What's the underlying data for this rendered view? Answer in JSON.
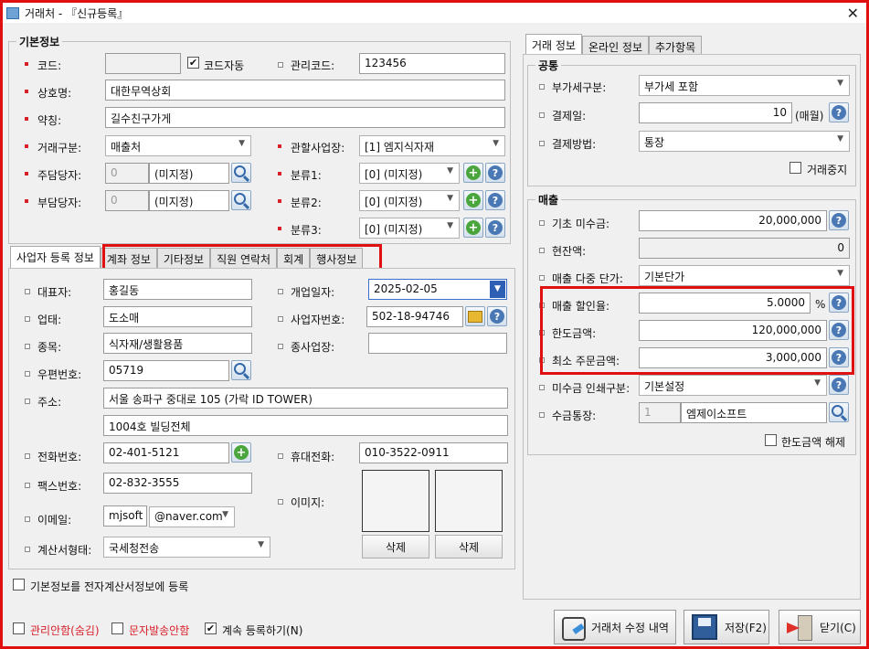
{
  "window": {
    "title": "거래처 - 『신규등록』"
  },
  "basic": {
    "group_title": "기본정보",
    "code_label": "코드:",
    "code_value": "",
    "auto_code_label": "코드자동",
    "auto_code_checked": "✔",
    "mgmt_code_label": "관리코드:",
    "mgmt_code_value": "123456",
    "name_label": "상호명:",
    "name_value": "대한무역상회",
    "short_label": "약칭:",
    "short_value": "길수친구가게",
    "type_label": "거래구분:",
    "type_value": "매출처",
    "site_label": "관할사업장:",
    "site_value": "[1] 엠지식자재",
    "main_mgr_label": "주담당자:",
    "main_mgr_code": "0",
    "main_mgr_value": "(미지정)",
    "sub_mgr_label": "부담당자:",
    "sub_mgr_code": "0",
    "sub_mgr_value": "(미지정)",
    "cat1_label": "분류1:",
    "cat1_value": "[0] (미지정)",
    "cat2_label": "분류2:",
    "cat2_value": "[0] (미지정)",
    "cat3_label": "분류3:",
    "cat3_value": "[0] (미지정)"
  },
  "left_tabs": [
    "사업자 등록 정보",
    "계좌 정보",
    "기타정보",
    "직원 연락처",
    "회계",
    "행사정보"
  ],
  "biz": {
    "ceo_label": "대표자:",
    "ceo_value": "홍길동",
    "open_label": "개업일자:",
    "open_value": "2025-02-05",
    "biztype_label": "업태:",
    "biztype_value": "도소매",
    "bizno_label": "사업자번호:",
    "bizno_value": "502-18-94746",
    "item_label": "종목:",
    "item_value": "식자재/생활용품",
    "branch_label": "종사업장:",
    "branch_value": "",
    "zip_label": "우편번호:",
    "zip_value": "05719",
    "addr_label": "주소:",
    "addr1_value": "서울 송파구 중대로 105 (가락 ID TOWER)",
    "addr2_value": "1004호 빌딩전체",
    "tel_label": "전화번호:",
    "tel_value": "02-401-5121",
    "mobile_label": "휴대전화:",
    "mobile_value": "010-3522-0911",
    "fax_label": "팩스번호:",
    "fax_value": "02-832-3555",
    "image_label": "이미지:",
    "email_label": "이메일:",
    "email_id": "mjsoft",
    "email_domain": "@naver.com",
    "invoice_label": "계산서형태:",
    "invoice_value": "국세청전송",
    "delete1": "삭제",
    "delete2": "삭제"
  },
  "register_einvoice_label": "기본정보를 전자계산서정보에 등록",
  "right_tabs": [
    "거래 정보",
    "온라인 정보",
    "추가항목"
  ],
  "common": {
    "group_title": "공통",
    "vat_label": "부가세구분:",
    "vat_value": "부가세 포함",
    "payday_label": "결제일:",
    "payday_value": "10",
    "payday_unit": "(매월)",
    "paymethod_label": "결제방법:",
    "paymethod_value": "통장",
    "stop_label": "거래중지"
  },
  "sales": {
    "group_title": "매출",
    "base_ar_label": "기초 미수금:",
    "base_ar_value": "20,000,000",
    "balance_label": "현잔액:",
    "balance_value": "0",
    "multi_price_label": "매출 다중 단가:",
    "multi_price_value": "기본단가",
    "discount_label": "매출 할인율:",
    "discount_value": "5.0000",
    "discount_unit": "%",
    "limit_label": "한도금액:",
    "limit_value": "120,000,000",
    "min_order_label": "최소 주문금액:",
    "min_order_value": "3,000,000",
    "ar_print_label": "미수금 인쇄구분:",
    "ar_print_value": "기본설정",
    "account_label": "수금통장:",
    "account_code": "1",
    "account_value": "엠제이소프트",
    "limit_release_label": "한도금액 해제"
  },
  "footer": {
    "hide_label": "관리안함(숨김)",
    "nosms_label": "문자발송안함",
    "continue_label": "계속 등록하기(N)",
    "continue_checked": "✔",
    "history_button": "거래처 수정 내역",
    "save_button": "저장(F2)",
    "close_button": "닫기(C)"
  }
}
